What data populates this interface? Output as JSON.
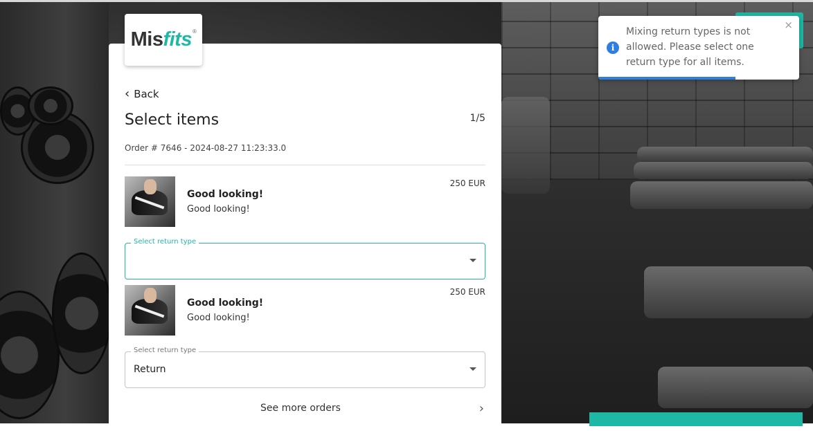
{
  "brand": {
    "logo_left": "Mis",
    "logo_right": "fits",
    "logo_mark": "®"
  },
  "nav": {
    "back_label": "Back"
  },
  "page": {
    "title": "Select items",
    "step": "1/5",
    "order_info": "Order # 7646 - 2024-08-27 11:23:33.0"
  },
  "items": [
    {
      "name": "Good looking!",
      "description": "Good looking!",
      "price": "250 EUR",
      "select": {
        "label": "Select return type",
        "value": ""
      }
    },
    {
      "name": "Good looking!",
      "description": "Good looking!",
      "price": "250 EUR",
      "select": {
        "label": "Select return type",
        "value": "Return"
      }
    }
  ],
  "footer": {
    "see_more_label": "See more orders"
  },
  "toast": {
    "message": "Mixing return types is not allowed. Please select one return type for all items.",
    "icon": "info-icon",
    "close": "×"
  },
  "colors": {
    "accent": "#1fb8a6",
    "info": "#2f7de1"
  }
}
